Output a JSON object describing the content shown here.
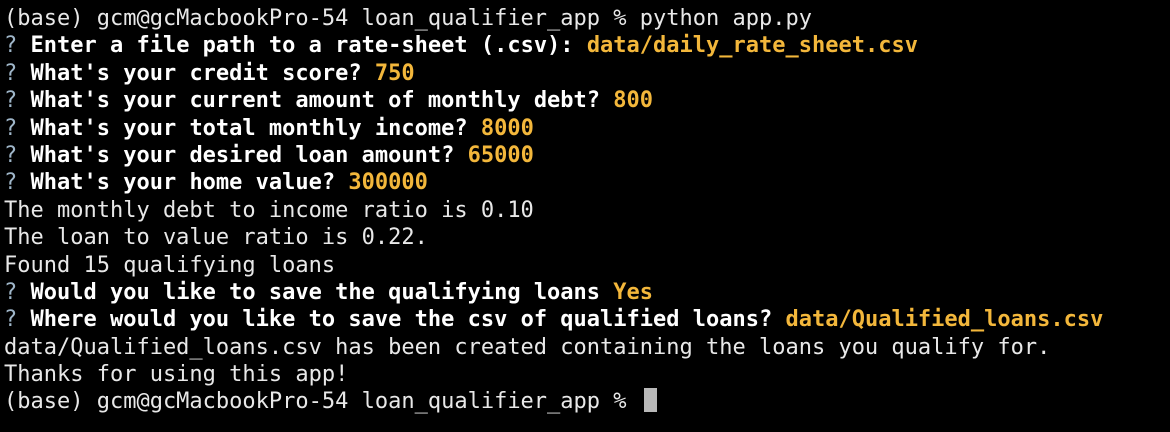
{
  "terminal": {
    "command_prompt": "(base) gcm@gcMacbookPro-54 loan_qualifier_app % python app.py",
    "question_marker": "?",
    "prompts": [
      {
        "question": "Enter a file path to a rate-sheet (.csv):",
        "answer": "data/daily_rate_sheet.csv"
      },
      {
        "question": "What's your credit score?",
        "answer": "750"
      },
      {
        "question": "What's your current amount of monthly debt?",
        "answer": "800"
      },
      {
        "question": "What's your total monthly income?",
        "answer": "8000"
      },
      {
        "question": "What's your desired loan amount?",
        "answer": "65000"
      },
      {
        "question": "What's your home value?",
        "answer": "300000"
      }
    ],
    "output_lines": [
      "The monthly debt to income ratio is 0.10",
      "The loan to value ratio is 0.22.",
      "Found 15 qualifying loans"
    ],
    "save_prompts": [
      {
        "question": "Would you like to save the qualifying loans",
        "answer": "Yes"
      },
      {
        "question": "Where would you like to save the csv of qualified loans?",
        "answer": "data/Qualified_loans.csv"
      }
    ],
    "final_lines": [
      "data/Qualified_loans.csv has been created containing the loans you qualify for.",
      "Thanks for using this app!"
    ],
    "final_prompt": "(base) gcm@gcMacbookPro-54 loan_qualifier_app % ",
    "colors": {
      "background": "#000000",
      "text": "#e8e8e8",
      "question_text": "#ffffff",
      "answer_text": "#f3b73b",
      "cursor": "#b9b9b9"
    }
  }
}
